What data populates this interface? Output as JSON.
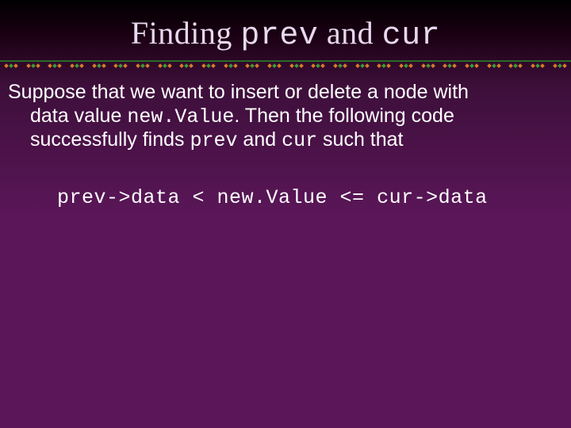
{
  "title": {
    "part1": "Finding ",
    "code1": "prev",
    "part2": " and ",
    "code2": "cur"
  },
  "body": {
    "line1_a": "Suppose that we want to insert or delete a node with",
    "line2_a": "data value ",
    "line2_code": "new.Value",
    "line2_b": ". Then the following code",
    "line3_a": "successfully finds ",
    "line3_code1": "prev",
    "line3_b": " and ",
    "line3_code2": "cur",
    "line3_c": " such that"
  },
  "code": {
    "expr": "prev->data < new.Value <= cur->data"
  }
}
